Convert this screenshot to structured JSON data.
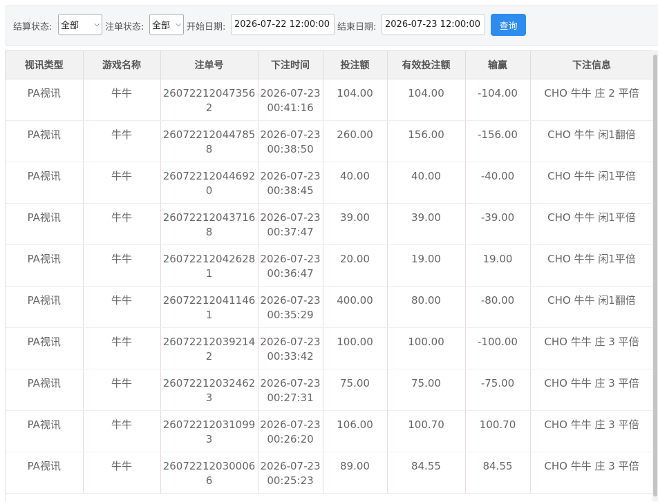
{
  "filters": {
    "settle_status_label": "结算状态:",
    "settle_status_value": "全部",
    "bet_status_label": "注单状态:",
    "bet_status_value": "全部",
    "start_date_label": "开始日期:",
    "start_date_value": "2026-07-22 12:00:00",
    "end_date_label": "结束日期:",
    "end_date_value": "2026-07-23 12:00:00",
    "query_button": "查询"
  },
  "table": {
    "headers": [
      "视讯类型",
      "游戏名称",
      "注单号",
      "下注时间",
      "投注额",
      "有效投注额",
      "输赢",
      "下注信息"
    ],
    "rows": [
      [
        "PA视讯",
        "牛牛",
        "260722120473562",
        "2026-07-23 00:41:16",
        "104.00",
        "104.00",
        "-104.00",
        "CHO 牛牛 庄 2 平倍"
      ],
      [
        "PA视讯",
        "牛牛",
        "260722120447858",
        "2026-07-23 00:38:50",
        "260.00",
        "156.00",
        "-156.00",
        "CHO 牛牛 闲1翻倍"
      ],
      [
        "PA视讯",
        "牛牛",
        "260722120446920",
        "2026-07-23 00:38:45",
        "40.00",
        "40.00",
        "-40.00",
        "CHO 牛牛 闲1平倍"
      ],
      [
        "PA视讯",
        "牛牛",
        "260722120437168",
        "2026-07-23 00:37:47",
        "39.00",
        "39.00",
        "-39.00",
        "CHO 牛牛 闲1平倍"
      ],
      [
        "PA视讯",
        "牛牛",
        "260722120426281",
        "2026-07-23 00:36:47",
        "20.00",
        "19.00",
        "19.00",
        "CHO 牛牛 闲1平倍"
      ],
      [
        "PA视讯",
        "牛牛",
        "260722120411461",
        "2026-07-23 00:35:29",
        "400.00",
        "80.00",
        "-80.00",
        "CHO 牛牛 闲1翻倍"
      ],
      [
        "PA视讯",
        "牛牛",
        "260722120392142",
        "2026-07-23 00:33:42",
        "100.00",
        "100.00",
        "-100.00",
        "CHO 牛牛 庄 3 平倍"
      ],
      [
        "PA视讯",
        "牛牛",
        "260722120324623",
        "2026-07-23 00:27:31",
        "75.00",
        "75.00",
        "-75.00",
        "CHO 牛牛 庄 3 平倍"
      ],
      [
        "PA视讯",
        "牛牛",
        "260722120310993",
        "2026-07-23 00:26:20",
        "106.00",
        "100.70",
        "100.70",
        "CHO 牛牛 庄 3 平倍"
      ],
      [
        "PA视讯",
        "牛牛",
        "260722120300066",
        "2026-07-23 00:25:23",
        "89.00",
        "84.55",
        "84.55",
        "CHO 牛牛 庄 3 平倍"
      ]
    ]
  }
}
